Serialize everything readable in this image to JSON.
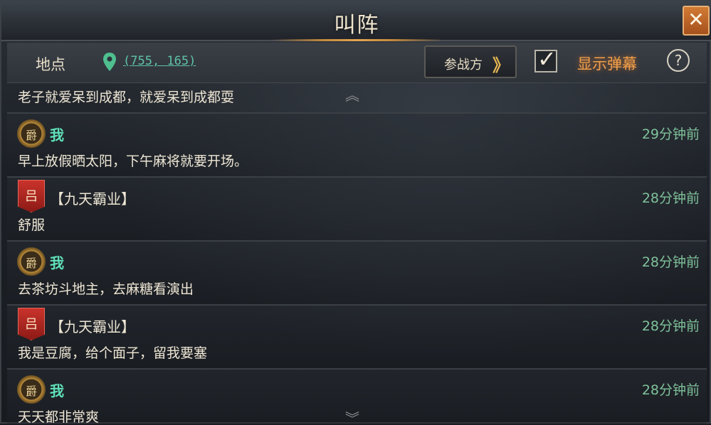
{
  "window": {
    "title": "叫阵",
    "close_glyph": "✕"
  },
  "info": {
    "location_label": "地点",
    "location_icon": "map-pin-icon",
    "coords": "(755, 165)",
    "join_button": "参战方",
    "join_chevron": "》",
    "barrage_checked": true,
    "barrage_label": "显示弹幕",
    "help_glyph": "?"
  },
  "messages": {
    "partial_first": "老子就爱呆到成都，就爱呆到成都耍",
    "items": [
      {
        "sender": "我",
        "avatar": "爵",
        "time": "29分钟前",
        "text": "早上放假晒太阳，下午麻将就要开场。"
      },
      {
        "sender": "【九天霸业】",
        "avatar": "吕",
        "time": "28分钟前",
        "text": "舒服"
      },
      {
        "sender": "我",
        "avatar": "爵",
        "time": "28分钟前",
        "text": "去茶坊斗地主，去麻糖看演出"
      },
      {
        "sender": "【九天霸业】",
        "avatar": "吕",
        "time": "28分钟前",
        "text": "我是豆腐，给个面子，留我要塞"
      },
      {
        "sender": "我",
        "avatar": "爵",
        "time": "28分钟前",
        "text": "天天都非常爽"
      }
    ]
  },
  "colors": {
    "accent_orange": "#f2a04a",
    "me_name": "#5fe0b8",
    "time": "#7fc29a",
    "coords": "#5fc2a8"
  }
}
